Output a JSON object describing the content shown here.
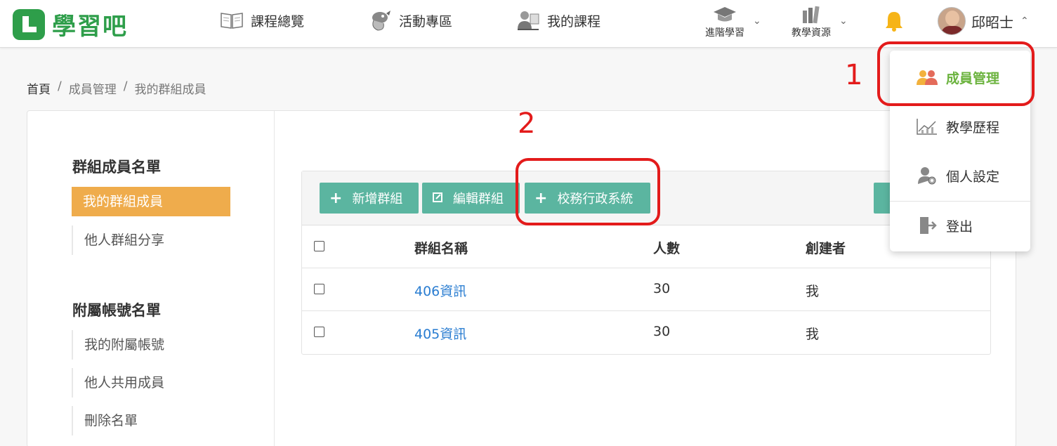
{
  "header": {
    "logo_text": "學習吧",
    "nav": [
      {
        "label": "課程總覽",
        "icon": "book-icon"
      },
      {
        "label": "活動專區",
        "icon": "dragon-icon"
      },
      {
        "label": "我的課程",
        "icon": "teacher-icon"
      }
    ],
    "sub_nav": [
      {
        "label": "進階學習",
        "icon": "graduation-cap-icon"
      },
      {
        "label": "教學資源",
        "icon": "books-icon"
      }
    ],
    "user_name": "邱昭士"
  },
  "breadcrumb": {
    "home": "首頁",
    "sep": "/",
    "level1": "成員管理",
    "level2": "我的群組成員"
  },
  "sidebar": {
    "section1_title": "群組成員名單",
    "section1_items": [
      "我的群組成員",
      "他人群組分享"
    ],
    "section2_title": "附屬帳號名單",
    "section2_items": [
      "我的附屬帳號",
      "他人共用成員",
      "刪除名單"
    ]
  },
  "toolbar": {
    "add_group": "新增群組",
    "edit_group": "編輯群組",
    "school_admin": "校務行政系統"
  },
  "table": {
    "headers": [
      "群組名稱",
      "人數",
      "創建者"
    ],
    "rows": [
      {
        "name": "406資訊",
        "count": "30",
        "creator": "我"
      },
      {
        "name": "405資訊",
        "count": "30",
        "creator": "我"
      }
    ]
  },
  "dropdown": {
    "items": [
      {
        "label": "成員管理",
        "icon": "members-icon"
      },
      {
        "label": "教學歷程",
        "icon": "chart-icon"
      },
      {
        "label": "個人設定",
        "icon": "user-settings-icon"
      },
      {
        "label": "登出",
        "icon": "logout-icon"
      }
    ]
  },
  "annotations": {
    "step1": "1",
    "step2": "2",
    "color": "#e31b1b"
  },
  "colors": {
    "brand_green": "#2e9e4a",
    "active_orange": "#efac4c",
    "button_teal": "#5bb5a0",
    "link_blue": "#2a7dd1",
    "active_green": "#6cb33f"
  }
}
